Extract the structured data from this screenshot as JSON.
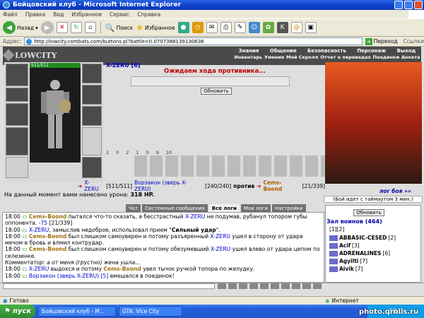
{
  "window": {
    "title": "Бойцовский клуб - Microsoft Internet Explorer"
  },
  "menu": [
    "Файл",
    "Правка",
    "Вид",
    "Избранное",
    "Сервис",
    "Справка"
  ],
  "toolbar": {
    "back": "Назад",
    "search": "Поиск",
    "favorites": "Избранное"
  },
  "address": {
    "label": "Адрес:",
    "url": "http://lowcity.combats.com/buttons.pl?battle=0.0707388139130636",
    "go": "Переход",
    "links": "Ссылки"
  },
  "site": {
    "logo": "LOWCITY",
    "nav_top": [
      "Знания",
      "Общение",
      "Безопасность",
      "Персонаж",
      "Выход"
    ],
    "nav_bottom": [
      "Инвентарь",
      "Умения",
      "Мой Скролл",
      "Отчет о переводах",
      "Поединки",
      "Анкета"
    ]
  },
  "player": {
    "name": "X-ZERU",
    "level": "[6]",
    "hp": "511/511"
  },
  "battle": {
    "wait_message": "Ожидаем хода противника...",
    "refresh_button": "Обновить",
    "counters": [
      "2",
      "0",
      "2",
      "1",
      "0",
      "9",
      "10"
    ],
    "team1_a": "X-ZERU",
    "team1_a_hp": "[511/511]",
    "team1_b": "Ворзакон (зверь X-ZERU)",
    "team1_b_hp": "[240/240]",
    "versus": "против",
    "team2": "Cems-Boond",
    "team2_hp": "[21/339]",
    "damage_text": "На данный момент вами нанесено урона:",
    "damage_value": "318 HP.",
    "log_link": "лог боя »»",
    "timeout": "(Бой идет с таймаутом 3 мин.)"
  },
  "tabs": [
    "Чат",
    "Системные сообщения",
    "Все логи",
    "Мои логи",
    "Настройки"
  ],
  "active_tab": "Все логи",
  "chat_lines": [
    {
      "time": "18:00",
      "parts": [
        {
          "c": "nb",
          "t": "Cems-Boond"
        },
        {
          "c": "t",
          "t": " пытался что-то сказать, а бесстрастный "
        },
        {
          "c": "nx",
          "t": "X-ZERU"
        },
        {
          "c": "t",
          "t": " не подумав, рубанул топором губы оппонента. "
        },
        {
          "c": "nx",
          "t": "-75"
        },
        {
          "c": "t",
          "t": " [21/339]"
        }
      ]
    },
    {
      "time": "18:00",
      "parts": [
        {
          "c": "nx",
          "t": "X-ZERU"
        },
        {
          "c": "t",
          "t": ", замыслив недоброе, использовал прием \""
        },
        {
          "c": "b",
          "t": "Сильный удар"
        },
        {
          "c": "t",
          "t": "\"."
        }
      ]
    },
    {
      "time": "18:00",
      "parts": [
        {
          "c": "nb",
          "t": "Cems-Boond"
        },
        {
          "c": "t",
          "t": " был слишком самоуверен и потому разъяренный "
        },
        {
          "c": "nx",
          "t": "X-ZERU"
        },
        {
          "c": "t",
          "t": " ушел в сторону от удара мечом в бровь и влмил контрудар."
        }
      ]
    },
    {
      "time": "18:00",
      "parts": [
        {
          "c": "nb",
          "t": "Cems-Boond"
        },
        {
          "c": "t",
          "t": " был слишком самоуверен и потому обезумевший "
        },
        {
          "c": "nx",
          "t": "X-ZERU"
        },
        {
          "c": "t",
          "t": " ушел влево от удара цепом по селезенке."
        }
      ]
    },
    {
      "time": "",
      "parts": [
        {
          "c": "t",
          "t": "Комментатор: а от меня (грустно) жена ушла..."
        }
      ]
    },
    {
      "time": "18:00",
      "parts": [
        {
          "c": "nx",
          "t": "X-ZERU"
        },
        {
          "c": "t",
          "t": " выдохся и потому "
        },
        {
          "c": "nb",
          "t": "Cems-Boond"
        },
        {
          "c": "t",
          "t": " увел тычок ручкой топора по желудку."
        }
      ]
    },
    {
      "time": "18:00",
      "parts": [
        {
          "c": "nx",
          "t": "Ворзакон (зверь X-ZERU) [5]"
        },
        {
          "c": "t",
          "t": " вмешался в поединок!"
        }
      ]
    }
  ],
  "players_panel": {
    "update_button": "Обновить",
    "hall": "Зал воинов (464)",
    "pages": "[1][2]",
    "list": [
      {
        "name": "ABBASIC-CESED",
        "level": "[2]"
      },
      {
        "name": "Acif",
        "level": "[3]"
      },
      {
        "name": "ADRENALINES",
        "level": "[6]"
      },
      {
        "name": "Agyilti",
        "level": "[7]"
      },
      {
        "name": "Aivik",
        "level": "[7]"
      }
    ]
  },
  "status": {
    "left": "Готово",
    "right": "Интернет"
  },
  "taskbar": {
    "start": "пуск",
    "tasks": [
      "Бойцовский клуб - M...",
      "GTA: Vice City"
    ],
    "clock": "18:0"
  },
  "watermark": "photo.qrolls.ru"
}
